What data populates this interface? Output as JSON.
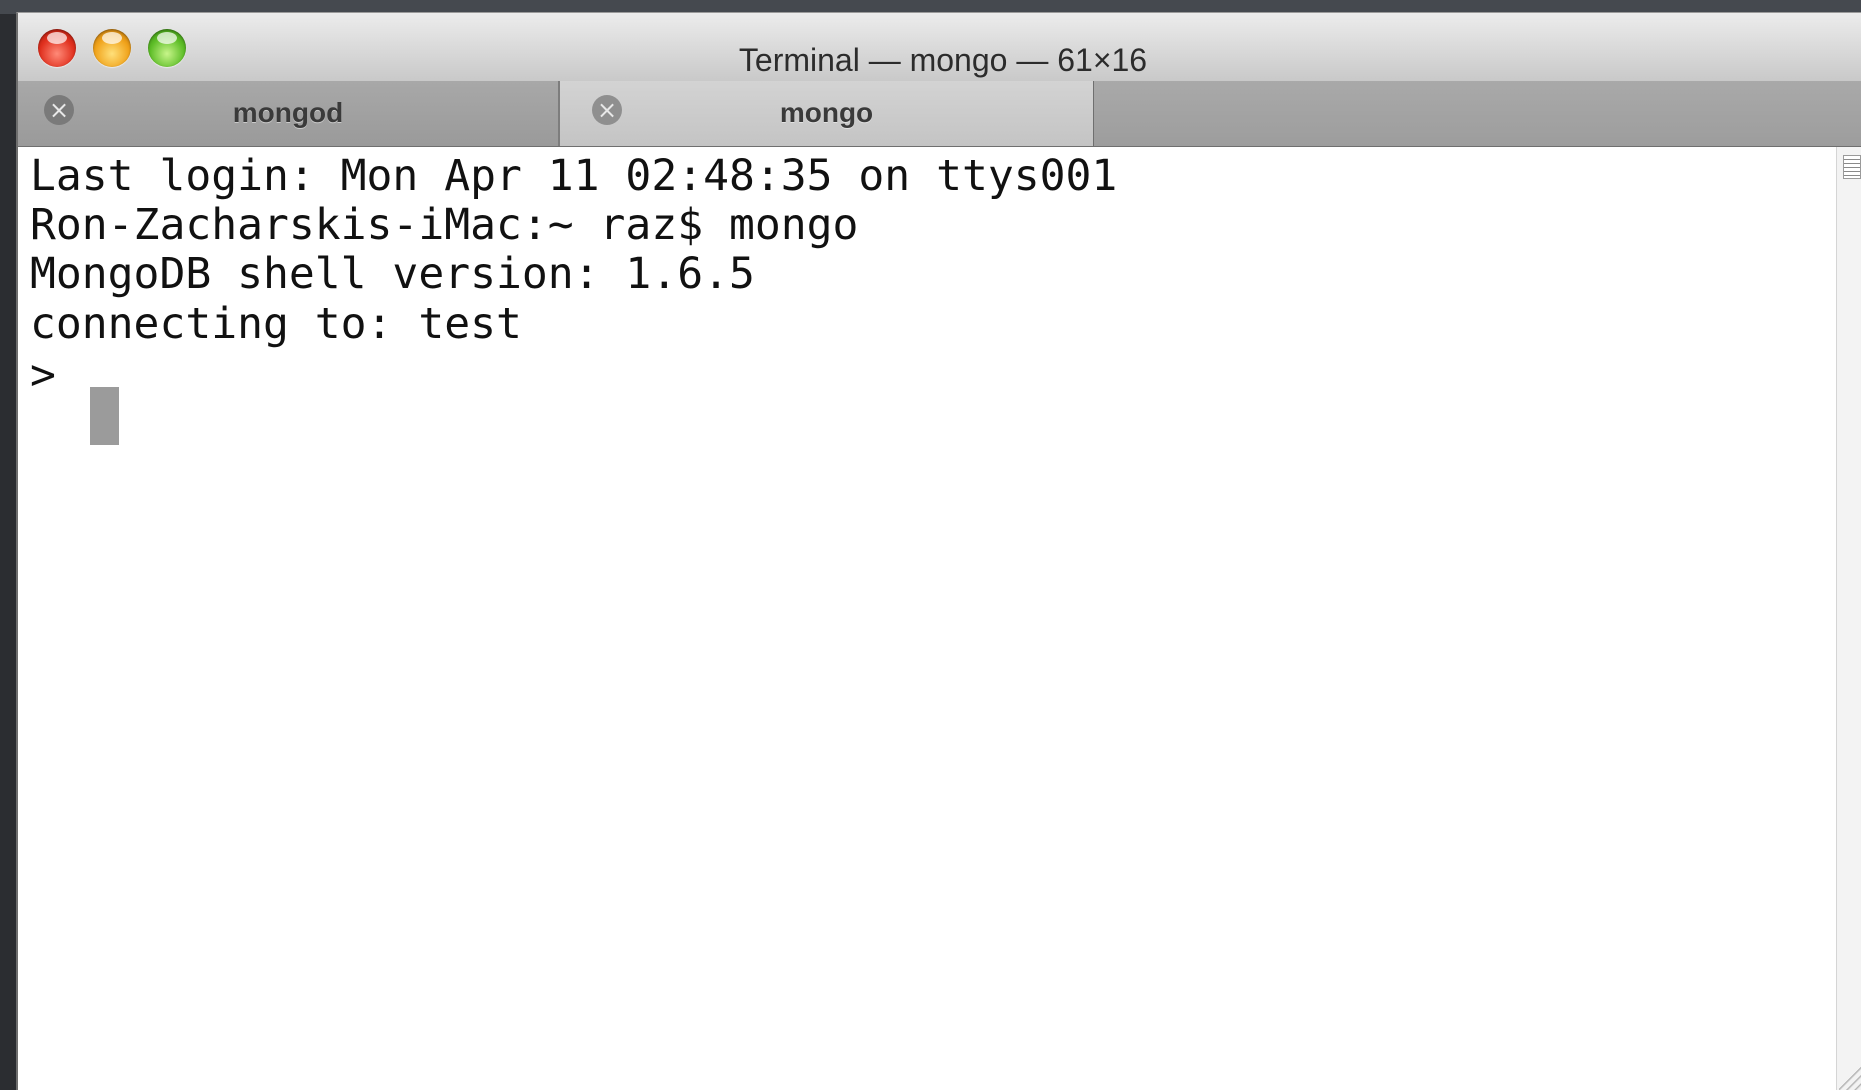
{
  "window": {
    "title": "Terminal — mongo — 61×16"
  },
  "tabs": [
    {
      "label": "mongod",
      "active": false,
      "close_icon": "×"
    },
    {
      "label": "mongo",
      "active": true,
      "close_icon": "×"
    }
  ],
  "terminal": {
    "lines": [
      "Last login: Mon Apr 11 02:48:35 on ttys001",
      "Ron-Zacharskis-iMac:~ raz$ mongo",
      "MongoDB shell version: 1.6.5",
      "connecting to: test",
      "> "
    ]
  },
  "icons": {
    "close": "close-icon",
    "minimize": "minimize-icon",
    "zoom": "zoom-icon",
    "tab_close": "tab-close-icon",
    "split": "split-pane-icon",
    "resize": "resize-grip-icon"
  },
  "colors": {
    "titlebar": "#d6d6d6",
    "tabbar": "#9d9d9d",
    "active_tab": "#c9c9c9",
    "terminal_bg": "#ffffff",
    "terminal_fg": "#111111",
    "cursor": "#9b9b9b",
    "close_button": "#e0301e",
    "minimize_button": "#f0a21a",
    "zoom_button": "#5dbd27"
  }
}
